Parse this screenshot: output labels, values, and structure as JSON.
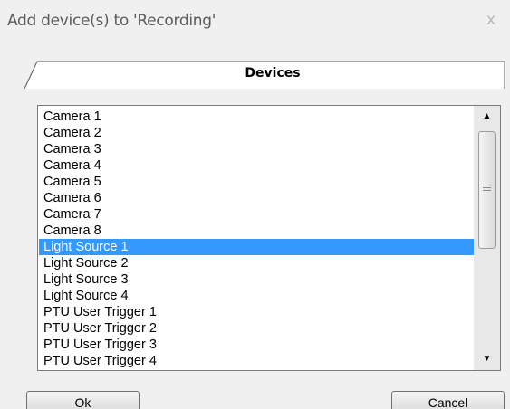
{
  "dialog": {
    "title": "Add device(s) to 'Recording'",
    "close_glyph": "x"
  },
  "tabs": [
    {
      "label": "Devices",
      "active": true
    }
  ],
  "device_list": {
    "items": [
      "Camera 1",
      "Camera 2",
      "Camera 3",
      "Camera 4",
      "Camera 5",
      "Camera 6",
      "Camera 7",
      "Camera 8",
      "Light Source 1",
      "Light Source 2",
      "Light Source 3",
      "Light Source 4",
      "PTU User Trigger 1",
      "PTU User Trigger 2",
      "PTU User Trigger 3",
      "PTU User Trigger 4"
    ],
    "selected_index": 8
  },
  "buttons": {
    "ok_label": "Ok",
    "cancel_label": "Cancel"
  },
  "colors": {
    "selection": "#3399ff",
    "dialog_background": "#f0f0f0"
  },
  "icons": {
    "scroll_up": "arrow-up-icon",
    "scroll_down": "arrow-down-icon",
    "thumb_grip": "grip-icon"
  }
}
